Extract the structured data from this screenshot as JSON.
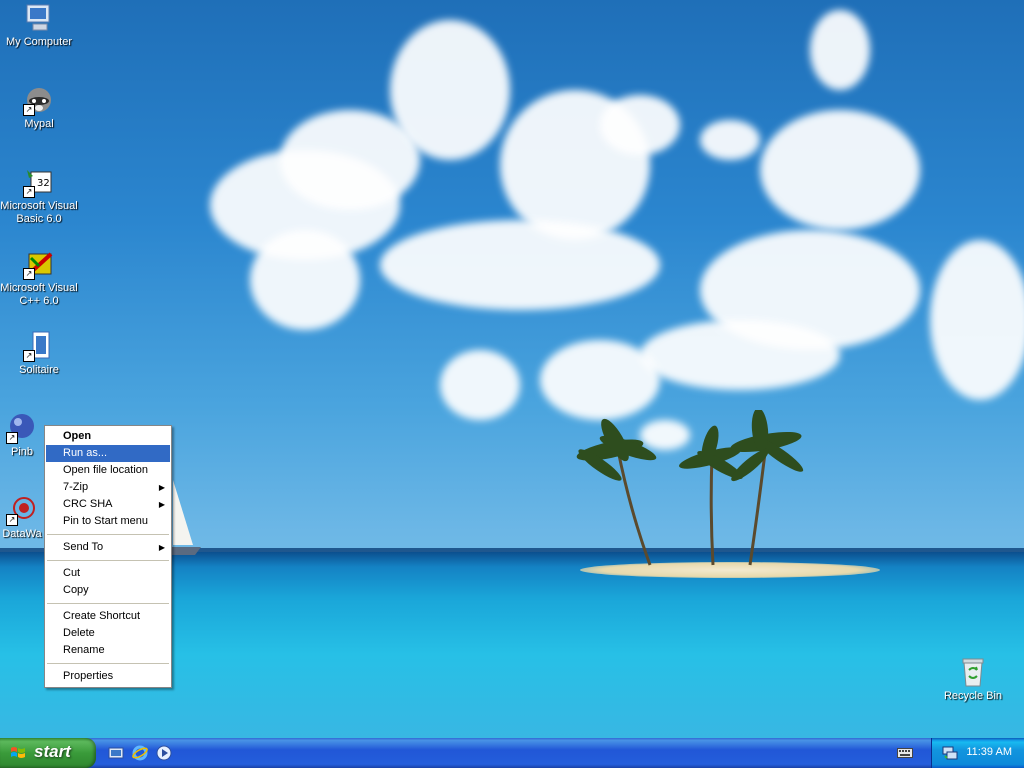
{
  "desktop_icons": [
    {
      "label": "My Computer",
      "icon": "my-computer-icon"
    },
    {
      "label": "Mypal",
      "icon": "raccoon-browser-icon"
    },
    {
      "label": "Microsoft Visual Basic 6.0",
      "icon": "visual-basic-icon"
    },
    {
      "label": "Microsoft Visual C++ 6.0",
      "icon": "visual-cpp-icon"
    },
    {
      "label": "Solitaire",
      "icon": "solitaire-cards-icon"
    },
    {
      "label": "Pinb",
      "icon": "pinball-icon"
    },
    {
      "label": "DataWa",
      "icon": "datawave-icon"
    },
    {
      "label": "Recycle Bin",
      "icon": "recycle-bin-icon"
    }
  ],
  "context_menu": {
    "items": [
      {
        "label": "Open",
        "bold": true
      },
      {
        "label": "Run as...",
        "highlighted": true
      },
      {
        "label": "Open file location"
      },
      {
        "label": "7-Zip",
        "submenu": true
      },
      {
        "label": "CRC SHA",
        "submenu": true
      },
      {
        "label": "Pin to Start menu"
      },
      {
        "label": "Send To",
        "submenu": true
      },
      {
        "label": "Cut"
      },
      {
        "label": "Copy"
      },
      {
        "label": "Create Shortcut"
      },
      {
        "label": "Delete"
      },
      {
        "label": "Rename"
      },
      {
        "label": "Properties"
      }
    ]
  },
  "taskbar": {
    "start_label": "start",
    "quick_launch": [
      "show-desktop-icon",
      "internet-explorer-icon",
      "media-player-icon"
    ],
    "tray_icons": [
      "keyboard-icon",
      "network-icon"
    ],
    "clock": "11:39 AM"
  },
  "colors": {
    "menu_highlight": "#316ac5",
    "taskbar_blue": "#245edb",
    "start_green": "#3a9b3a"
  }
}
